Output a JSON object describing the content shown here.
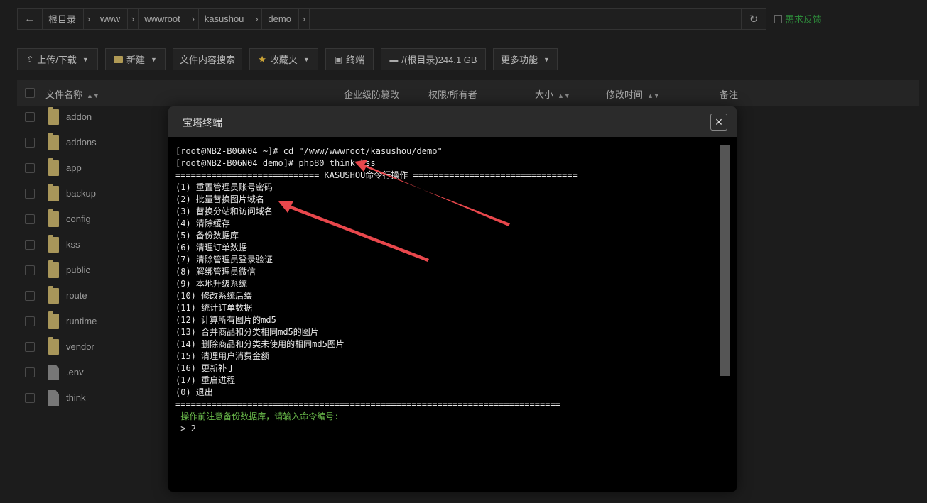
{
  "breadcrumb": {
    "back_icon": "arrow-left-icon",
    "items": [
      "根目录",
      "www",
      "wwwroot",
      "kasushou",
      "demo"
    ],
    "refresh_icon": "refresh-icon"
  },
  "feedback": {
    "label": "需求反馈",
    "color": "#2d8a3a"
  },
  "toolbar": {
    "upload_label": "上传/下载",
    "new_label": "新建",
    "search_label": "文件内容搜索",
    "favorites_label": "收藏夹",
    "terminal_label": "终端",
    "disk_label": "/(根目录)244.1 GB",
    "more_label": "更多功能"
  },
  "table": {
    "headers": {
      "name": "文件名称",
      "tamper": "企业级防篡改",
      "perm": "权限/所有者",
      "size": "大小",
      "mtime": "修改时间",
      "note": "备注"
    },
    "files": [
      {
        "name": "addon",
        "type": "folder"
      },
      {
        "name": "addons",
        "type": "folder"
      },
      {
        "name": "app",
        "type": "folder"
      },
      {
        "name": "backup",
        "type": "folder"
      },
      {
        "name": "config",
        "type": "folder"
      },
      {
        "name": "kss",
        "type": "folder"
      },
      {
        "name": "public",
        "type": "folder"
      },
      {
        "name": "route",
        "type": "folder"
      },
      {
        "name": "runtime",
        "type": "folder"
      },
      {
        "name": "vendor",
        "type": "folder"
      },
      {
        "name": ".env",
        "type": "file"
      },
      {
        "name": "think",
        "type": "file"
      }
    ]
  },
  "terminal": {
    "title": "宝塔终端",
    "close_icon": "close-icon",
    "lines": [
      "[root@NB2-B06N04 ~]# cd \"/www/wwwroot/kasushou/demo\"",
      "[root@NB2-B06N04 demo]# php80 think kss",
      "============================ KASUSHOU命令行操作 ================================",
      "(1) 重置管理员账号密码",
      "(2) 批量替换图片域名",
      "(3) 替换分站和访问域名",
      "(4) 清除缓存",
      "(5) 备份数据库",
      "(6) 清理订单数据",
      "(7) 清除管理员登录验证",
      "(8) 解绑管理员微信",
      "(9) 本地升级系统",
      "(10) 修改系统后缀",
      "(11) 统计订单数据",
      "(12) 计算所有图片的md5",
      "(13) 合并商品和分类相同md5的图片",
      "(14) 删除商品和分类未使用的相同md5图片",
      "(15) 清理用户消费金额",
      "(16) 更新补丁",
      "(17) 重启进程",
      "(0) 退出",
      "==========================================================================="
    ],
    "prompt": " 操作前注意备份数据库，请输入命令编号:",
    "input": " > 2",
    "prompt_color": "#69b94a",
    "arrow_color": "#e8474c"
  }
}
